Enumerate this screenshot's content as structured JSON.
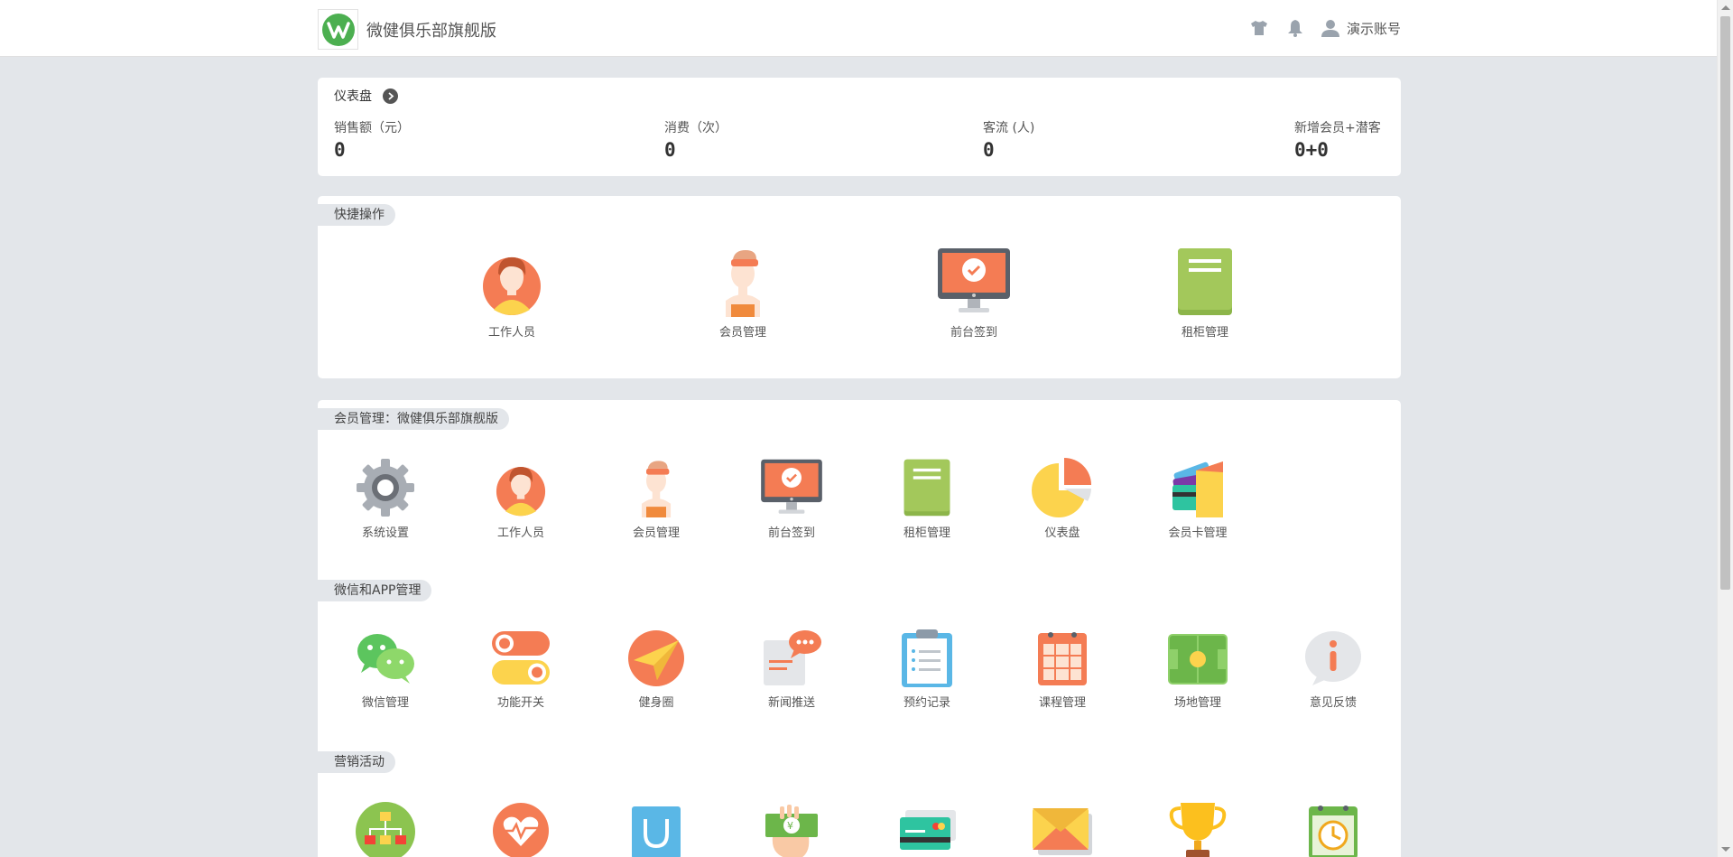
{
  "header": {
    "brand_title": "微健俱乐部旗舰版",
    "account_label": "演示账号",
    "icons": [
      "shirt-icon",
      "bell-icon",
      "user-icon"
    ]
  },
  "dashboard": {
    "title": "仪表盘",
    "stats": [
      {
        "label": "销售额（元）",
        "value": "0"
      },
      {
        "label": "消费（次）",
        "value": "0"
      },
      {
        "label": "客流 (人)",
        "value": "0"
      },
      {
        "label": "新增会员+潜客",
        "value": "0+0"
      }
    ]
  },
  "quick": {
    "title": "快捷操作",
    "items": [
      {
        "label": "工作人员",
        "icon": "staff-icon"
      },
      {
        "label": "会员管理",
        "icon": "member-icon"
      },
      {
        "label": "前台签到",
        "icon": "checkin-monitor-icon"
      },
      {
        "label": "租柜管理",
        "icon": "locker-icon"
      }
    ]
  },
  "member_mgmt": {
    "title": "会员管理：微健俱乐部旗舰版",
    "items": [
      {
        "label": "系统设置",
        "icon": "gear-icon"
      },
      {
        "label": "工作人员",
        "icon": "staff-icon"
      },
      {
        "label": "会员管理",
        "icon": "member-icon"
      },
      {
        "label": "前台签到",
        "icon": "checkin-monitor-icon"
      },
      {
        "label": "租柜管理",
        "icon": "locker-icon"
      },
      {
        "label": "仪表盘",
        "icon": "pie-chart-icon"
      },
      {
        "label": "会员卡管理",
        "icon": "member-card-icon"
      }
    ]
  },
  "wechat_app": {
    "title": "微信和APP管理",
    "items": [
      {
        "label": "微信管理",
        "icon": "wechat-icon"
      },
      {
        "label": "功能开关",
        "icon": "toggle-switch-icon"
      },
      {
        "label": "健身圈",
        "icon": "paper-plane-icon"
      },
      {
        "label": "新闻推送",
        "icon": "news-chat-icon"
      },
      {
        "label": "预约记录",
        "icon": "clipboard-icon"
      },
      {
        "label": "课程管理",
        "icon": "calendar-grid-icon"
      },
      {
        "label": "场地管理",
        "icon": "field-icon"
      },
      {
        "label": "意见反馈",
        "icon": "info-bubble-icon"
      }
    ]
  },
  "marketing": {
    "title": "营销活动",
    "items": [
      {
        "icon": "org-chart-icon"
      },
      {
        "icon": "heart-pulse-icon"
      },
      {
        "icon": "shopping-bag-icon"
      },
      {
        "icon": "cash-hand-icon"
      },
      {
        "icon": "credit-card-icon"
      },
      {
        "icon": "envelope-icon"
      },
      {
        "icon": "trophy-icon"
      },
      {
        "icon": "clock-calendar-icon"
      }
    ]
  },
  "colors": {
    "brand_green": "#4caf50",
    "accent_orange": "#f47c54",
    "page_bg": "#e3e6ea"
  }
}
